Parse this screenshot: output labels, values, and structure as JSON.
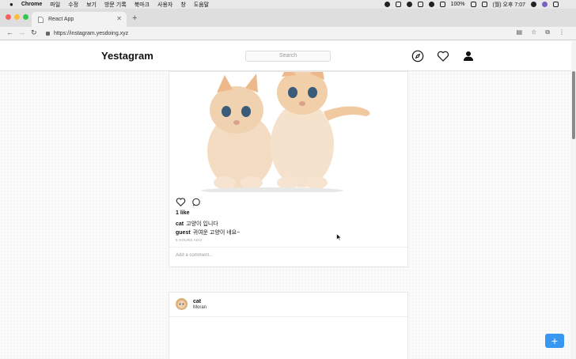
{
  "menubar": {
    "app": "Chrome",
    "items": [
      "파일",
      "수정",
      "보기",
      "방문 기록",
      "북마크",
      "사용자",
      "창",
      "도움말"
    ],
    "battery": "100%",
    "clock": "(월) 오후 7:07"
  },
  "browser": {
    "tab_title": "React App",
    "url": "https://instagram.yesdoing.xyz"
  },
  "header": {
    "logo": "Yestagram",
    "search_placeholder": "Search"
  },
  "post1": {
    "likes": "1 like",
    "comments": [
      {
        "user": "cat",
        "text": "고양이 입니다"
      },
      {
        "user": "guest",
        "text": "귀여운 고양이 네요~"
      }
    ],
    "time": "5 HOURS AGO",
    "add_comment_placeholder": "Add a comment..."
  },
  "post2": {
    "user": "cat",
    "location": "Moran"
  },
  "colors": {
    "accent": "#3897f0",
    "traffic_red": "#fc605c",
    "traffic_yellow": "#fdbc40",
    "traffic_green": "#34c84a"
  }
}
